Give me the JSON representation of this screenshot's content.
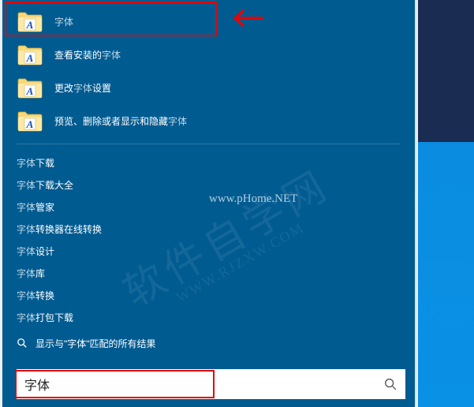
{
  "top_results": [
    {
      "pre": "",
      "hl": "字体",
      "post": ""
    },
    {
      "pre": "查看安装的",
      "hl": "字体",
      "post": ""
    },
    {
      "pre": "更改",
      "hl": "字体",
      "post": "设置"
    },
    {
      "pre": "预览、删除或者显示和隐藏",
      "hl": "字体",
      "post": ""
    }
  ],
  "web_suggestions": [
    {
      "hl": "字体",
      "post": "下载"
    },
    {
      "hl": "字体",
      "post": "下载大全"
    },
    {
      "hl": "字体",
      "post": "管家"
    },
    {
      "hl": "字体",
      "post": "转换器在线转换"
    },
    {
      "hl": "字体",
      "post": "设计"
    },
    {
      "hl": "字体",
      "post": "库"
    },
    {
      "hl": "字体",
      "post": "转换"
    },
    {
      "hl": "字体",
      "post": "打包下载"
    }
  ],
  "all_results": {
    "pre": "显示与\"",
    "hl": "字体",
    "post": "\"匹配的所有结果"
  },
  "search": {
    "value": "字体"
  },
  "watermark_url": "www.pHome.NET",
  "watermark_diag": "软件自学网",
  "watermark_diag_sub": "WWW.RJZXW.COM",
  "colors": {
    "panel": "#005b91",
    "dim": "#bed7e6",
    "highlight_border": "#e20606"
  }
}
